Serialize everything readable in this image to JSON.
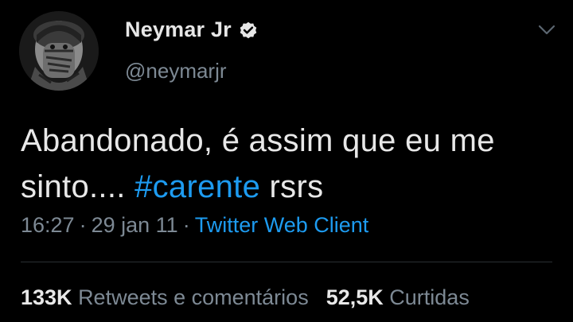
{
  "author": {
    "display_name": "Neymar Jr",
    "handle": "@neymarjr",
    "avatar_icon": "profile-photo",
    "verified_icon": "verified-badge-icon"
  },
  "tweet": {
    "text_before": "Abandonado, é assim que eu me sinto.... ",
    "hashtag": "#carente",
    "text_after": " rsrs"
  },
  "meta": {
    "time": "16:27",
    "separator": "·",
    "date": "29 jan 11",
    "source": "Twitter Web Client"
  },
  "stats": {
    "retweets_count": "133K",
    "retweets_label": "Retweets e comentários",
    "likes_count": "52,5K",
    "likes_label": "Curtidas"
  },
  "colors": {
    "background": "#000000",
    "accent": "#1d9bf0",
    "muted": "#7d8994"
  }
}
